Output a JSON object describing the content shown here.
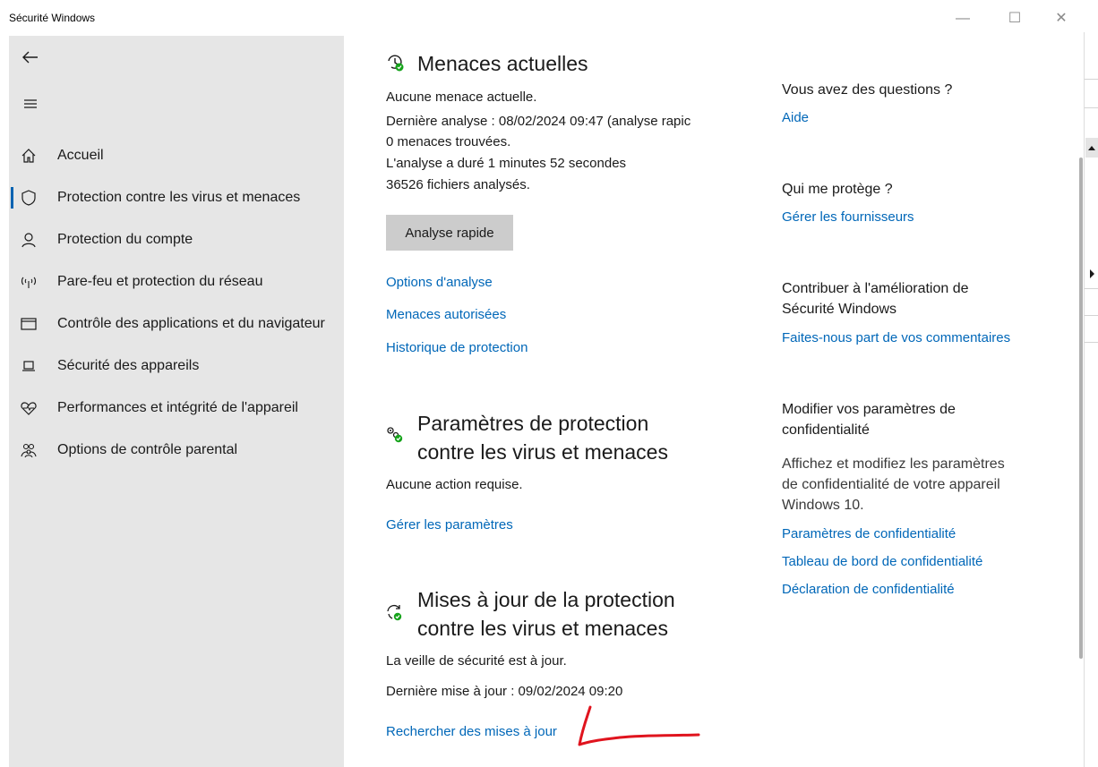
{
  "window": {
    "title": "Sécurité Windows",
    "minimize_glyph": "—",
    "maximize_glyph": "☐",
    "close_glyph": "✕"
  },
  "sidebar": {
    "back_icon": "back-arrow-icon",
    "menu_icon": "hamburger-menu-icon",
    "items": [
      {
        "label": "Accueil",
        "icon": "home-icon"
      },
      {
        "label": "Protection contre les virus et menaces",
        "icon": "shield-icon",
        "active": true
      },
      {
        "label": "Protection du compte",
        "icon": "person-icon"
      },
      {
        "label": "Pare-feu et protection du réseau",
        "icon": "wifi-antenna-icon"
      },
      {
        "label": "Contrôle des applications et du navigateur",
        "icon": "browser-window-icon"
      },
      {
        "label": "Sécurité des appareils",
        "icon": "laptop-icon"
      },
      {
        "label": "Performances et intégrité de l'appareil",
        "icon": "heart-pulse-icon"
      },
      {
        "label": "Options de contrôle parental",
        "icon": "family-icon"
      }
    ],
    "accent_color": "#0063b1"
  },
  "threats": {
    "title": "Menaces actuelles",
    "icon": "clock-shield-icon",
    "status": "Aucune menace actuelle.",
    "last_scan": "Dernière analyse : 08/02/2024 09:47 (analyse rapic",
    "found": "0 menaces trouvées.",
    "duration": "L'analyse a duré 1 minutes 52 secondes",
    "files": "36526 fichiers analysés.",
    "quick_scan_button": "Analyse rapide",
    "links": [
      "Options d'analyse",
      "Menaces autorisées",
      "Historique de protection"
    ]
  },
  "settings": {
    "title_line1": "Paramètres de protection",
    "title_line2": "contre les virus et menaces",
    "icon": "gears-check-icon",
    "status": "Aucune action requise.",
    "link": "Gérer les paramètres"
  },
  "updates": {
    "title_line1": "Mises à jour de la protection",
    "title_line2": "contre les virus et menaces",
    "icon": "refresh-check-icon",
    "status": "La veille de sécurité est à jour.",
    "last_update": "Dernière mise à jour : 09/02/2024 09:20",
    "link": "Rechercher des mises à jour"
  },
  "right_panel": {
    "questions_head": "Vous avez des questions ?",
    "questions_link": "Aide",
    "who_head": "Qui me protège ?",
    "who_link": "Gérer les fournisseurs",
    "contrib_head_line1": "Contribuer à l'amélioration de",
    "contrib_head_line2": "Sécurité Windows",
    "contrib_link": "Faites-nous part de vos commentaires",
    "privacy_head_line1": "Modifier vos paramètres de",
    "privacy_head_line2": "confidentialité",
    "privacy_text_line1": "Affichez et modifiez les paramètres",
    "privacy_text_line2": "de confidentialité de votre appareil",
    "privacy_text_line3": "Windows 10.",
    "privacy_links": [
      "Paramètres de confidentialité",
      "Tableau de bord de confidentialité",
      "Déclaration de confidentialité"
    ]
  },
  "colors": {
    "link": "#0067b8",
    "sidebar_bg": "#e6e6e6",
    "button_bg": "#cccccc",
    "ok_green": "#16a31b",
    "annotation_red": "#e0141e"
  }
}
